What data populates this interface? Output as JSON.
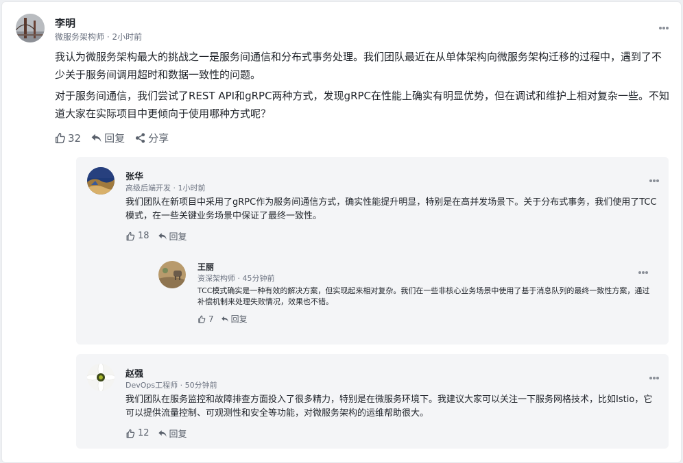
{
  "post": {
    "author": "李明",
    "role": "微服务架构师",
    "time": "2小时前",
    "paragraph_1": "我认为微服务架构最大的挑战之一是服务间通信和分布式事务处理。我们团队最近在从单体架构向微服务架构迁移的过程中，遇到了不少关于服务间调用超时和数据一致性的问题。",
    "paragraph_2": "对于服务间通信，我们尝试了REST API和gRPC两种方式，发现gRPC在性能上确实有明显优势，但在调试和维护上相对复杂一些。不知道大家在实际项目中更倾向于使用哪种方式呢？",
    "likes": "32",
    "reply_label": "回复",
    "share_label": "分享"
  },
  "replies": [
    {
      "author": "张华",
      "role": "高级后端开发",
      "time": "1小时前",
      "text": "我们团队在新项目中采用了gRPC作为服务间通信方式，确实性能提升明显，特别是在高并发场景下。关于分布式事务，我们使用了TCC模式，在一些关键业务场景中保证了最终一致性。",
      "likes": "18",
      "reply_label": "回复",
      "nested": {
        "author": "王丽",
        "role": "资深架构师",
        "time": "45分钟前",
        "text": "TCC模式确实是一种有效的解决方案，但实现起来相对复杂。我们在一些非核心业务场景中使用了基于消息队列的最终一致性方案，通过补偿机制来处理失败情况，效果也不错。",
        "likes": "7",
        "reply_label": "回复"
      }
    },
    {
      "author": "赵强",
      "role": "DevOps工程师",
      "time": "50分钟前",
      "text": "我们团队在服务监控和故障排查方面投入了很多精力，特别是在微服务环境下。我建议大家可以关注一下服务网格技术，比如Istio，它可以提供流量控制、可观测性和安全等功能，对微服务架构的运维帮助很大。",
      "likes": "12",
      "reply_label": "回复"
    }
  ],
  "separator": " · "
}
